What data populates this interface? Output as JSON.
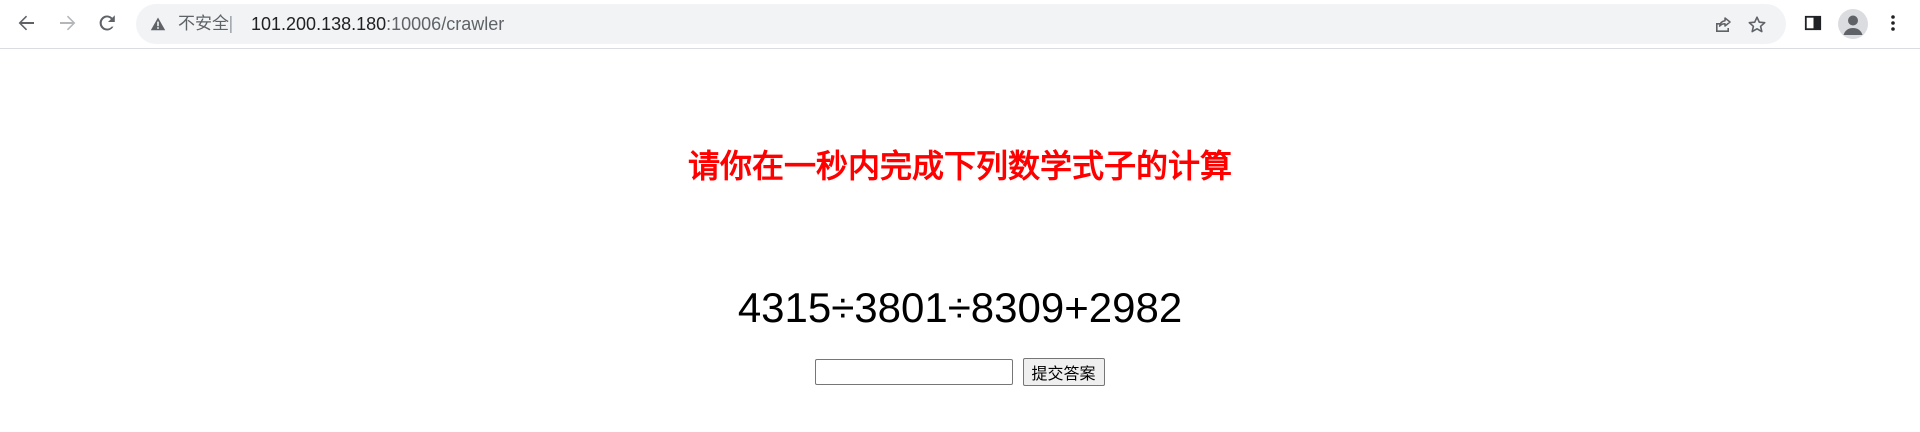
{
  "browser": {
    "security_label": "不安全",
    "separator": "|",
    "url_host": "101.200.138.180",
    "url_rest": ":10006/crawler",
    "icons": {
      "back": "arrow-left-icon",
      "forward": "arrow-right-icon",
      "reload": "reload-icon",
      "warning": "warning-triangle-icon",
      "share": "share-icon",
      "bookmark": "star-icon",
      "side_panel": "side-panel-icon",
      "profile": "profile-avatar-icon",
      "menu": "kebab-menu-icon"
    }
  },
  "page": {
    "heading": "请你在一秒内完成下列数学式子的计算",
    "heading_color": "#ff0000",
    "expression": "4315÷3801÷8309+2982",
    "answer_input_value": "",
    "submit_label": "提交答案"
  }
}
